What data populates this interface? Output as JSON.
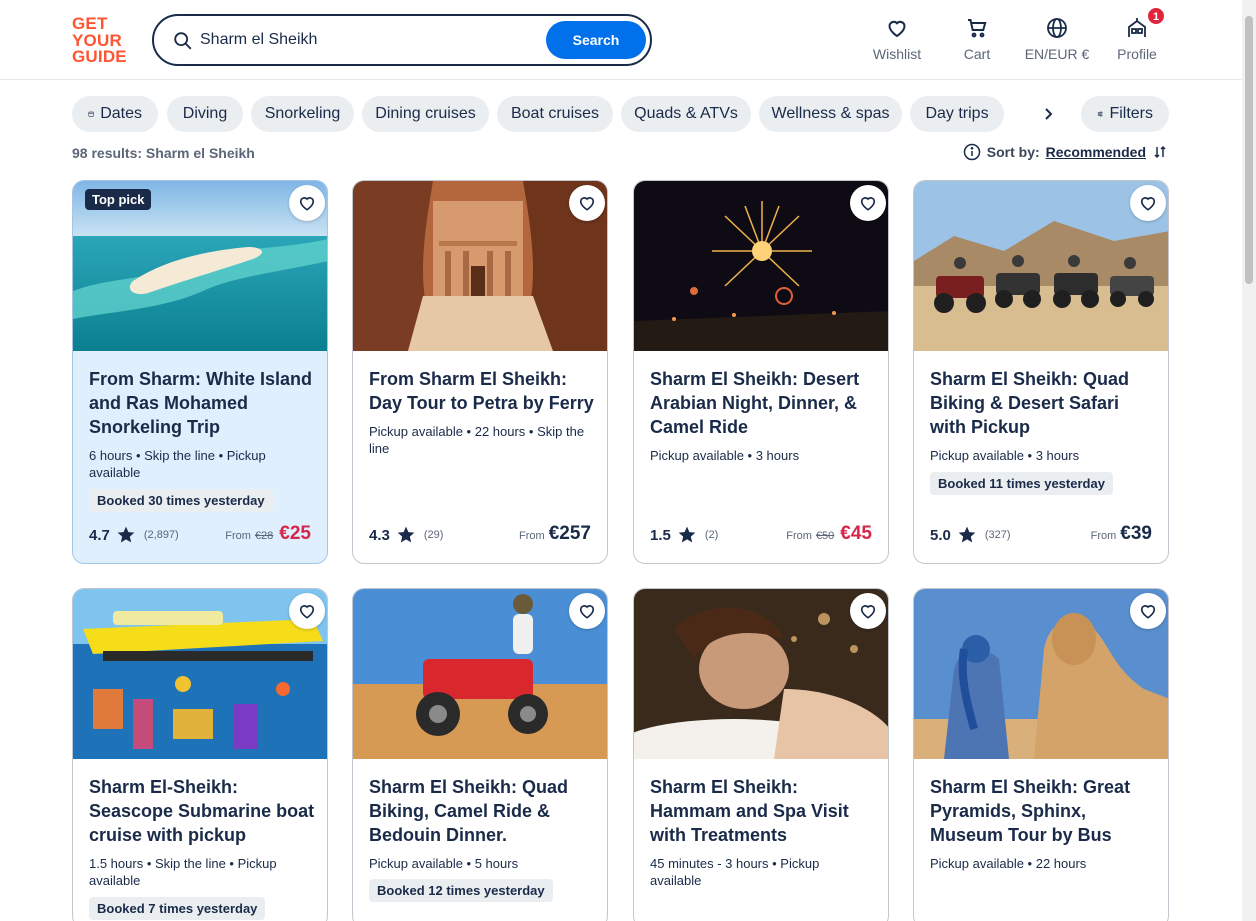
{
  "logo": {
    "line1": "GET",
    "line2": "YOUR",
    "line3": "GUIDE"
  },
  "search": {
    "value": "Sharm el Sheikh",
    "button": "Search"
  },
  "nav": {
    "wishlist": "Wishlist",
    "cart": "Cart",
    "language": "EN/EUR €",
    "profile": "Profile",
    "profile_badge": "1"
  },
  "chips": [
    "Dates",
    "Diving",
    "Snorkeling",
    "Dining cruises",
    "Boat cruises",
    "Quads & ATVs",
    "Wellness & spas",
    "Day trips"
  ],
  "filters_label": "Filters",
  "results_text": "98 results: Sharm el Sheikh",
  "sort": {
    "label": "Sort by:",
    "value": "Recommended"
  },
  "cards": [
    {
      "badge": "Top pick",
      "title": "From Sharm: White Island and Ras Mohamed Snorkeling Trip",
      "meta": "6 hours • Skip the line • Pickup available",
      "booked": "Booked 30 times yesterday",
      "rating": "4.7",
      "reviews": "(2,897)",
      "from": "From",
      "old_price": "€28",
      "price": "€25"
    },
    {
      "title": "From Sharm El Sheikh: Day Tour to Petra by Ferry",
      "meta": "Pickup available • 22 hours • Skip the line",
      "rating": "4.3",
      "reviews": "(29)",
      "from": "From",
      "price": "€257"
    },
    {
      "title": "Sharm El Sheikh: Desert Arabian Night, Dinner, & Camel Ride",
      "meta": "Pickup available • 3 hours",
      "rating": "1.5",
      "reviews": "(2)",
      "from": "From",
      "old_price": "€50",
      "price": "€45"
    },
    {
      "title": "Sharm El Sheikh: Quad Biking & Desert Safari with Pickup",
      "meta": "Pickup available • 3 hours",
      "booked": "Booked 11 times yesterday",
      "rating": "5.0",
      "reviews": "(327)",
      "from": "From",
      "price": "€39"
    },
    {
      "title": "Sharm El-Sheikh: Seascope Submarine boat cruise with pickup",
      "meta": "1.5 hours • Skip the line • Pickup available",
      "booked": "Booked 7 times yesterday"
    },
    {
      "title": "Sharm El Sheikh: Quad Biking, Camel Ride & Bedouin Dinner.",
      "meta": "Pickup available • 5 hours",
      "booked": "Booked 12 times yesterday"
    },
    {
      "title": "Sharm El Sheikh: Hammam and Spa Visit with Treatments",
      "meta": "45 minutes - 3 hours • Pickup available"
    },
    {
      "title": "Sharm El Sheikh: Great Pyramids, Sphinx, Museum Tour by Bus",
      "meta": "Pickup available • 22 hours"
    }
  ],
  "colors": {
    "brand": "#ff5533",
    "accent": "#0071eb",
    "navy": "#1a2b49",
    "sale": "#d8254a"
  }
}
